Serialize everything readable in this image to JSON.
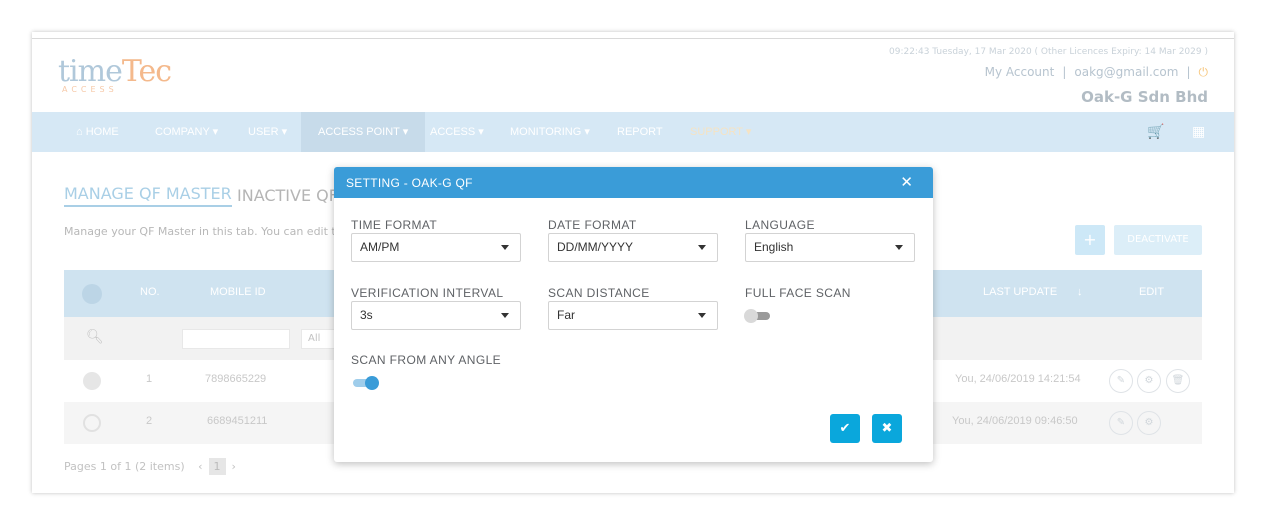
{
  "header": {
    "logo_main": "time",
    "logo_tec": "Tec",
    "logo_sub": "ACCESS",
    "datetime": "09:22:43 Tuesday, 17 Mar 2020 ( Other Licences Expiry: 14 Mar 2029 )",
    "my_account": "My Account",
    "separator": "|",
    "email": "oakg@gmail.com",
    "company": "Oak-G Sdn Bhd"
  },
  "nav": {
    "items": [
      {
        "label": "⌂ HOME"
      },
      {
        "label": "COMPANY ▾"
      },
      {
        "label": "USER ▾"
      },
      {
        "label": "ACCESS POINT ▾"
      },
      {
        "label": "ACCESS ▾"
      },
      {
        "label": "MONITORING ▾"
      },
      {
        "label": "REPORT"
      },
      {
        "label": "SUPPORT ▾"
      }
    ]
  },
  "page": {
    "tab_active": "MANAGE QF MASTER",
    "tab_inactive": "INACTIVE QF",
    "description": "Manage your QF Master in this tab. You can edit the",
    "add_label": "+",
    "deactivate_label": "DEACTIVATE"
  },
  "table": {
    "headers": {
      "no": "NO.",
      "mobile_id": "MOBILE ID",
      "last_update": "LAST UPDATE",
      "sort": "↓",
      "edit": "EDIT"
    },
    "filter_all": "All",
    "rows": [
      {
        "no": "1",
        "mobile_id": "7898665229",
        "last_update": "You, 24/06/2019 14:21:54"
      },
      {
        "no": "2",
        "mobile_id": "6689451211",
        "last_update": "You, 24/06/2019 09:46:50"
      }
    ],
    "pager": {
      "text": "Pages 1 of 1 (2 items)",
      "prev": "‹",
      "page": "1",
      "next": "›"
    }
  },
  "modal": {
    "title": "SETTING - OAK-G QF",
    "close": "✕",
    "time_format": {
      "label": "TIME FORMAT",
      "value": "AM/PM"
    },
    "date_format": {
      "label": "DATE FORMAT",
      "value": "DD/MM/YYYY"
    },
    "language": {
      "label": "LANGUAGE",
      "value": "English"
    },
    "verification_interval": {
      "label": "VERIFICATION INTERVAL",
      "value": "3s"
    },
    "scan_distance": {
      "label": "SCAN DISTANCE",
      "value": "Far"
    },
    "full_face_scan": {
      "label": "FULL FACE SCAN",
      "enabled": false
    },
    "scan_any_angle": {
      "label": "SCAN FROM ANY ANGLE",
      "enabled": true
    },
    "ok": "✔",
    "cancel": "✖"
  },
  "colors": {
    "accent": "#3a9cd8",
    "button": "#0aa7dc"
  }
}
